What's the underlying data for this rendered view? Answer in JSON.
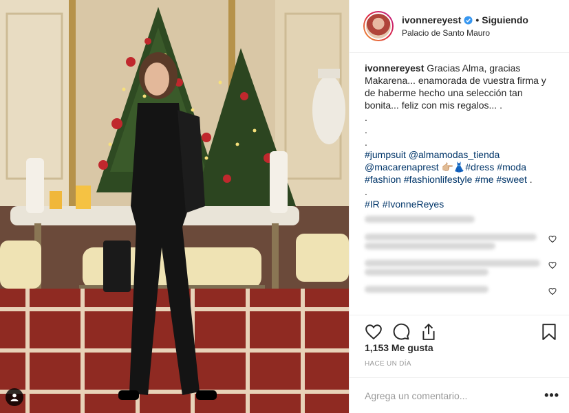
{
  "post": {
    "username": "ivonnereyest",
    "verified": true,
    "follow_status": "Siguiendo",
    "separator": "•",
    "location": "Palacio de Santo Mauro",
    "caption": {
      "username": "ivonnereyest",
      "text_lines": [
        "Gracias Alma, gracias Makarena... enamorada de vuestra firma y de haberme hecho una selección tan bonita... feliz con mis regalos... ."
      ],
      "dots": [
        ".",
        ".",
        "."
      ],
      "tags_line1": [
        "#jumpsuit",
        "@almamodas_tienda"
      ],
      "tags_line2_mention": "@macarenaprest",
      "tags_line2_emoji": "👉🏼👗",
      "tags_line2_rest": [
        "#dress",
        "#moda"
      ],
      "tags_line3": [
        "#fashion",
        "#fashionlifestyle",
        "#me",
        "#sweet"
      ],
      "tags_line3_end": ".",
      "dot_after": ".",
      "tags_line4": [
        "#IR",
        "#IvonneReyes"
      ]
    },
    "likes_text": "1,153 Me gusta",
    "time_text": "HACE UN DÍA",
    "comment_placeholder": "Agrega un comentario...",
    "more_label": "•••",
    "icons": {
      "like": "heart-icon",
      "comment": "comment-icon",
      "share": "share-icon",
      "save": "bookmark-icon",
      "tag": "user-tag-icon",
      "verified": "verified-badge-icon"
    }
  },
  "colors": {
    "link": "#003569",
    "text": "#262626",
    "muted": "#999999",
    "verified": "#3897f0"
  }
}
